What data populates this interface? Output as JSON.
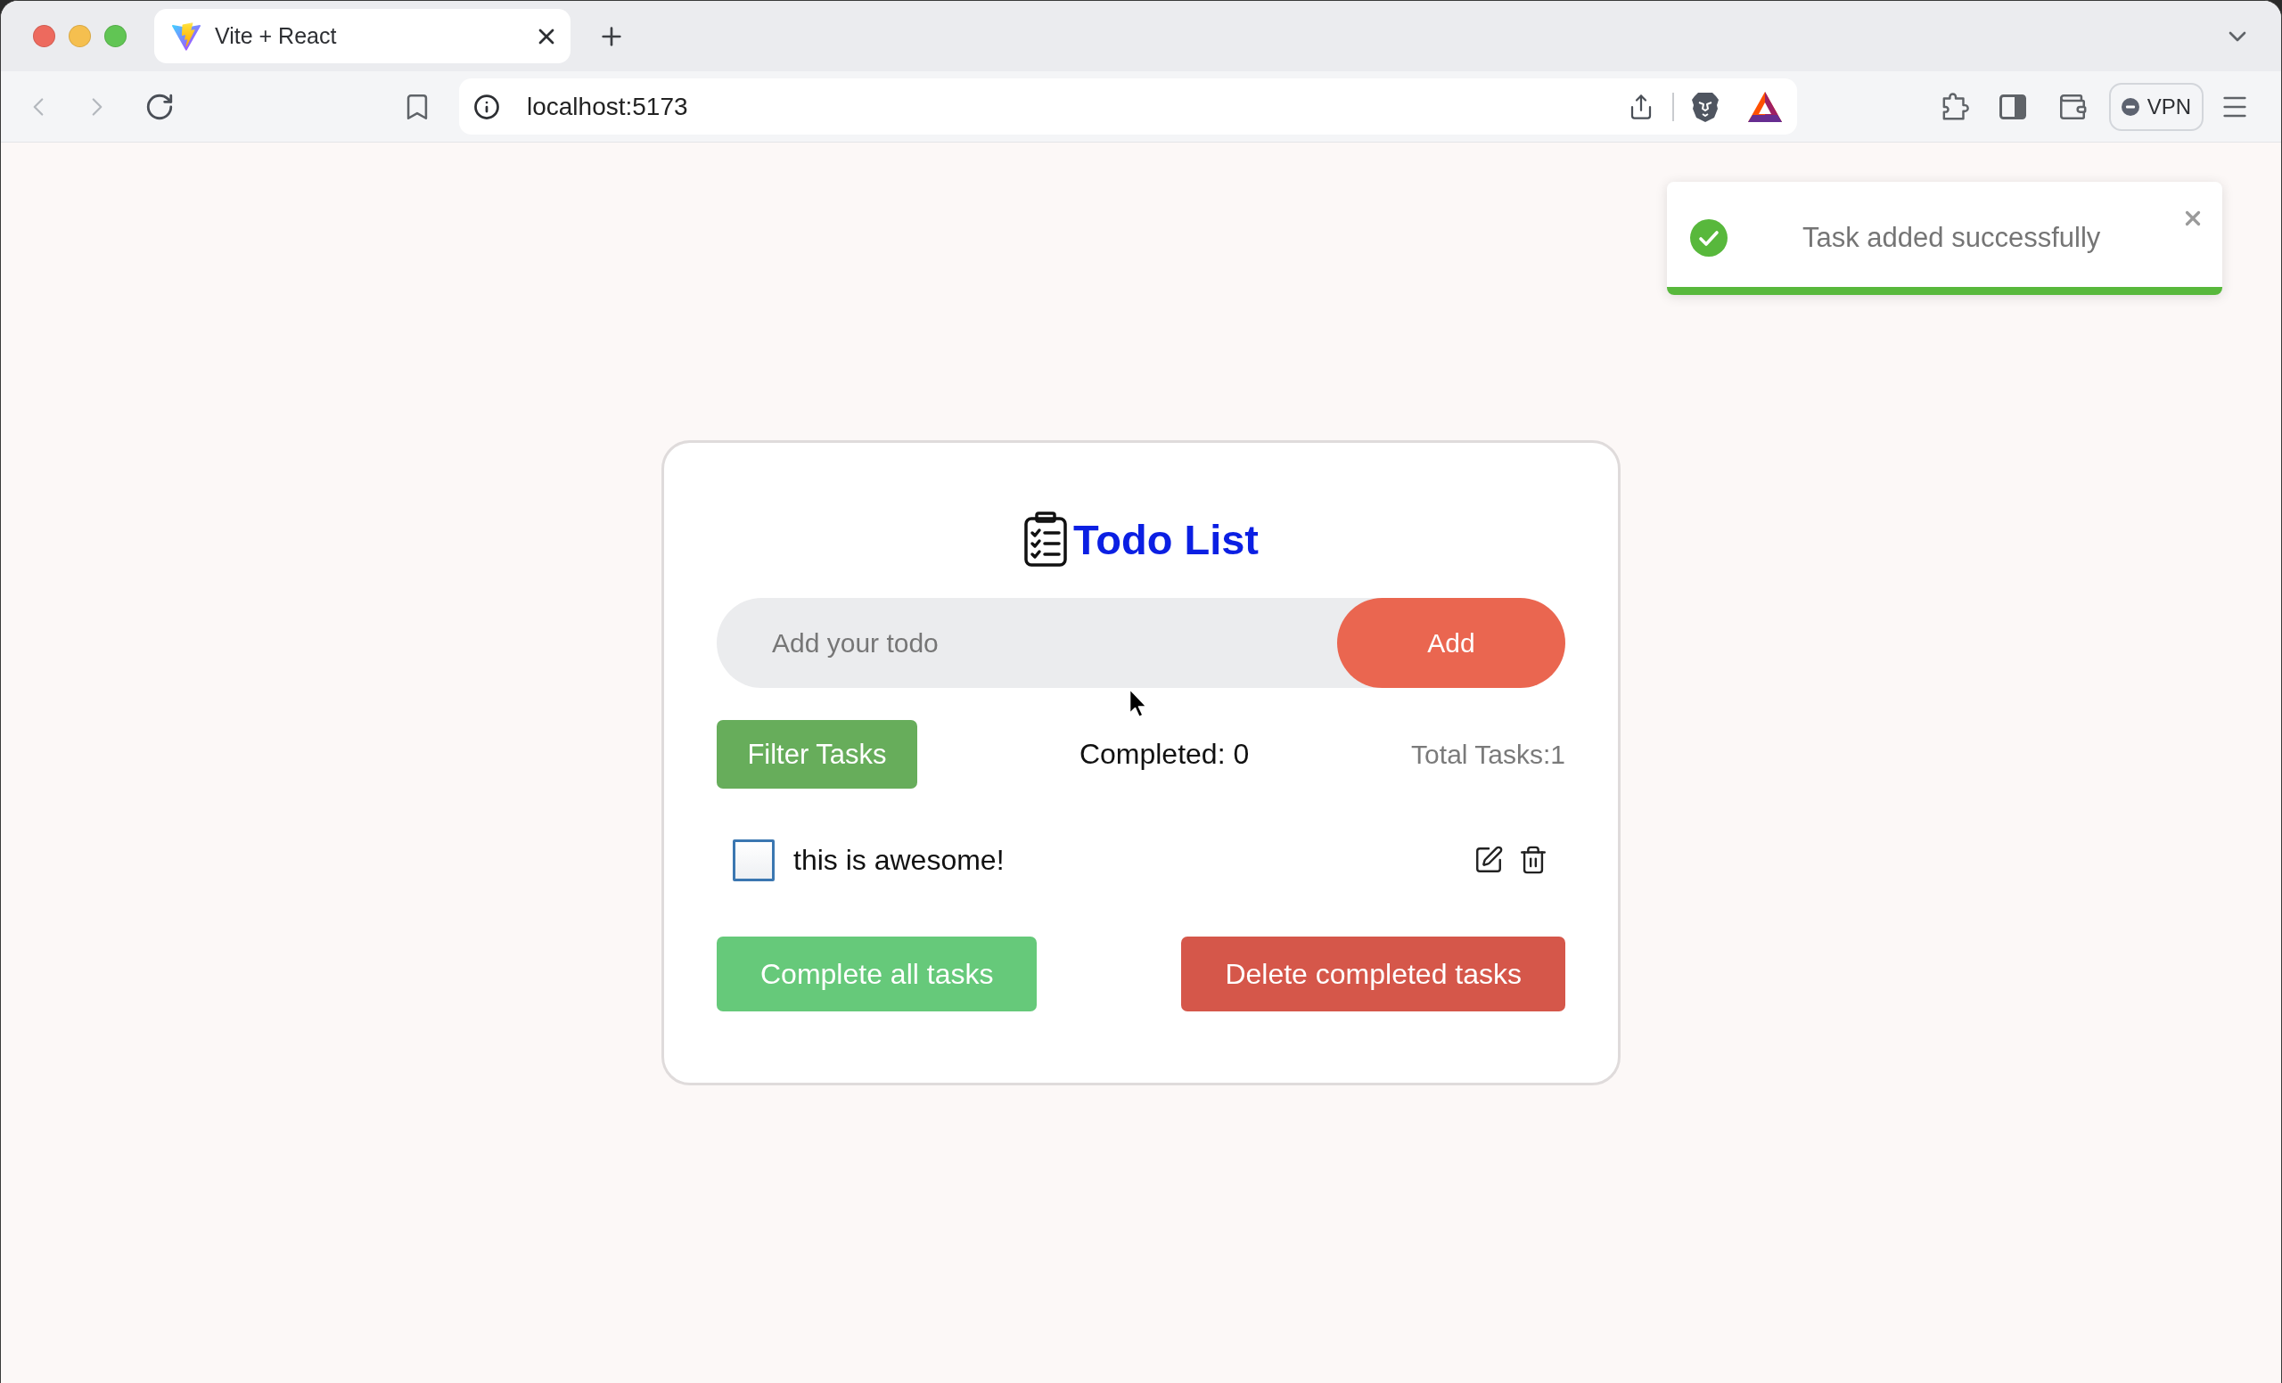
{
  "browser": {
    "tabs": [
      {
        "title": "Vite + React",
        "selected": true
      }
    ],
    "back_disabled": true,
    "forward_disabled": true,
    "address": "localhost:5173",
    "vpn_label": "VPN"
  },
  "toast": {
    "kind": "success",
    "message": "Task added successfully",
    "level": 1
  },
  "app": {
    "title": "Todo List",
    "input": {
      "placeholder": "Add your todo"
    },
    "add_button": "Add",
    "filter_button": "Filter Tasks",
    "completed_count": "Completed: 0",
    "total_count": "Total Tasks:1",
    "tasks": [
      {
        "text": "this is awesome!",
        "checked": false
      }
    ],
    "actions": [
      {
        "kind": "complete",
        "label": "Complete all tasks"
      },
      {
        "kind": "delete",
        "label": "Delete completed tasks"
      }
    ]
  }
}
